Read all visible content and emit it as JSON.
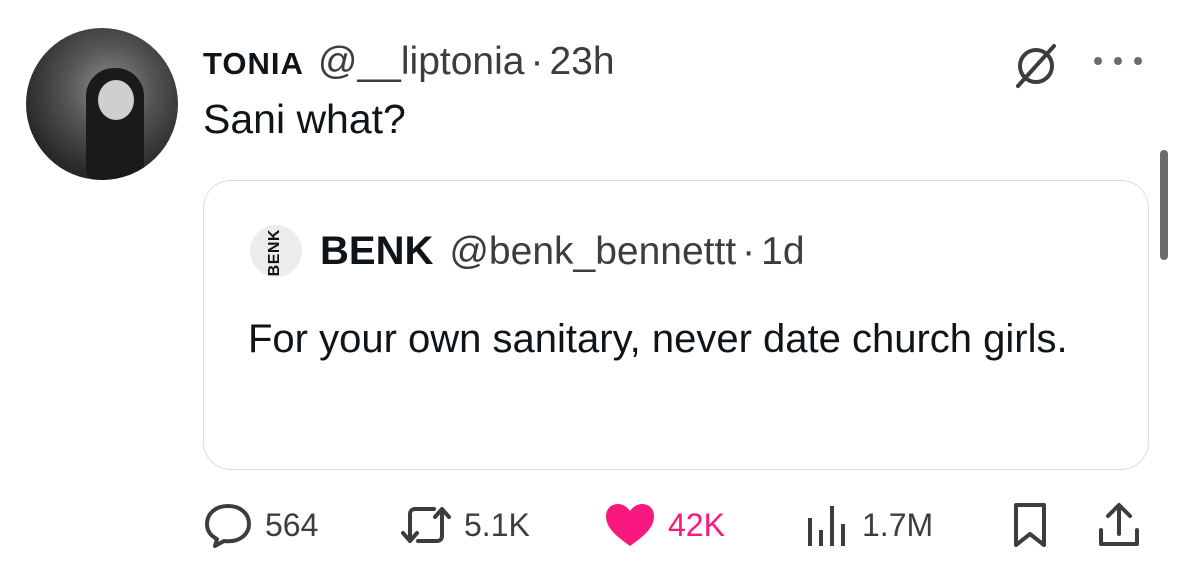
{
  "tweet": {
    "author_name": "TONIA",
    "author_handle": "@__liptonia",
    "separator": "·",
    "time": "23h",
    "text": "Sani what?"
  },
  "quoted_tweet": {
    "avatar_text": "BENK",
    "author_name": "BENK",
    "author_handle": "@benk_bennettt",
    "separator": "·",
    "time": "1d",
    "text": "For your own sanitary, never date church girls."
  },
  "actions": {
    "replies": "564",
    "reposts": "5.1K",
    "likes": "42K",
    "views": "1.7M"
  },
  "icons": {
    "reply": "reply-icon",
    "repost": "repost-icon",
    "like": "heart-icon",
    "views": "views-icon",
    "bookmark": "bookmark-icon",
    "share": "share-icon",
    "grok": "grok-icon",
    "more": "more-icon"
  },
  "colors": {
    "text": "#0f1419",
    "secondary_text": "#3d3d3d",
    "like": "#f91880",
    "border": "#d9dde1"
  }
}
